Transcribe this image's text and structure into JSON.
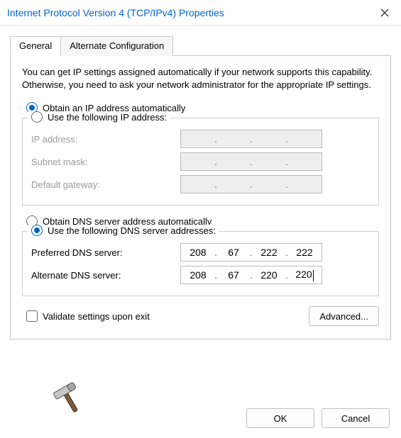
{
  "window": {
    "title": "Internet Protocol Version 4 (TCP/IPv4) Properties"
  },
  "tabs": {
    "general": "General",
    "alternate": "Alternate Configuration"
  },
  "description": "You can get IP settings assigned automatically if your network supports this capability. Otherwise, you need to ask your network administrator for the appropriate IP settings.",
  "ip": {
    "auto_label": "Obtain an IP address automatically",
    "manual_label": "Use the following IP address:",
    "address_label": "IP address:",
    "subnet_label": "Subnet mask:",
    "gateway_label": "Default gateway:"
  },
  "dns": {
    "auto_label": "Obtain DNS server address automatically",
    "manual_label": "Use the following DNS server addresses:",
    "preferred_label": "Preferred DNS server:",
    "alternate_label": "Alternate DNS server:",
    "preferred": {
      "o1": "208",
      "o2": "67",
      "o3": "222",
      "o4": "222"
    },
    "alternate": {
      "o1": "208",
      "o2": "67",
      "o3": "220",
      "o4": "220"
    }
  },
  "validate_label": "Validate settings upon exit",
  "buttons": {
    "advanced": "Advanced...",
    "ok": "OK",
    "cancel": "Cancel"
  }
}
